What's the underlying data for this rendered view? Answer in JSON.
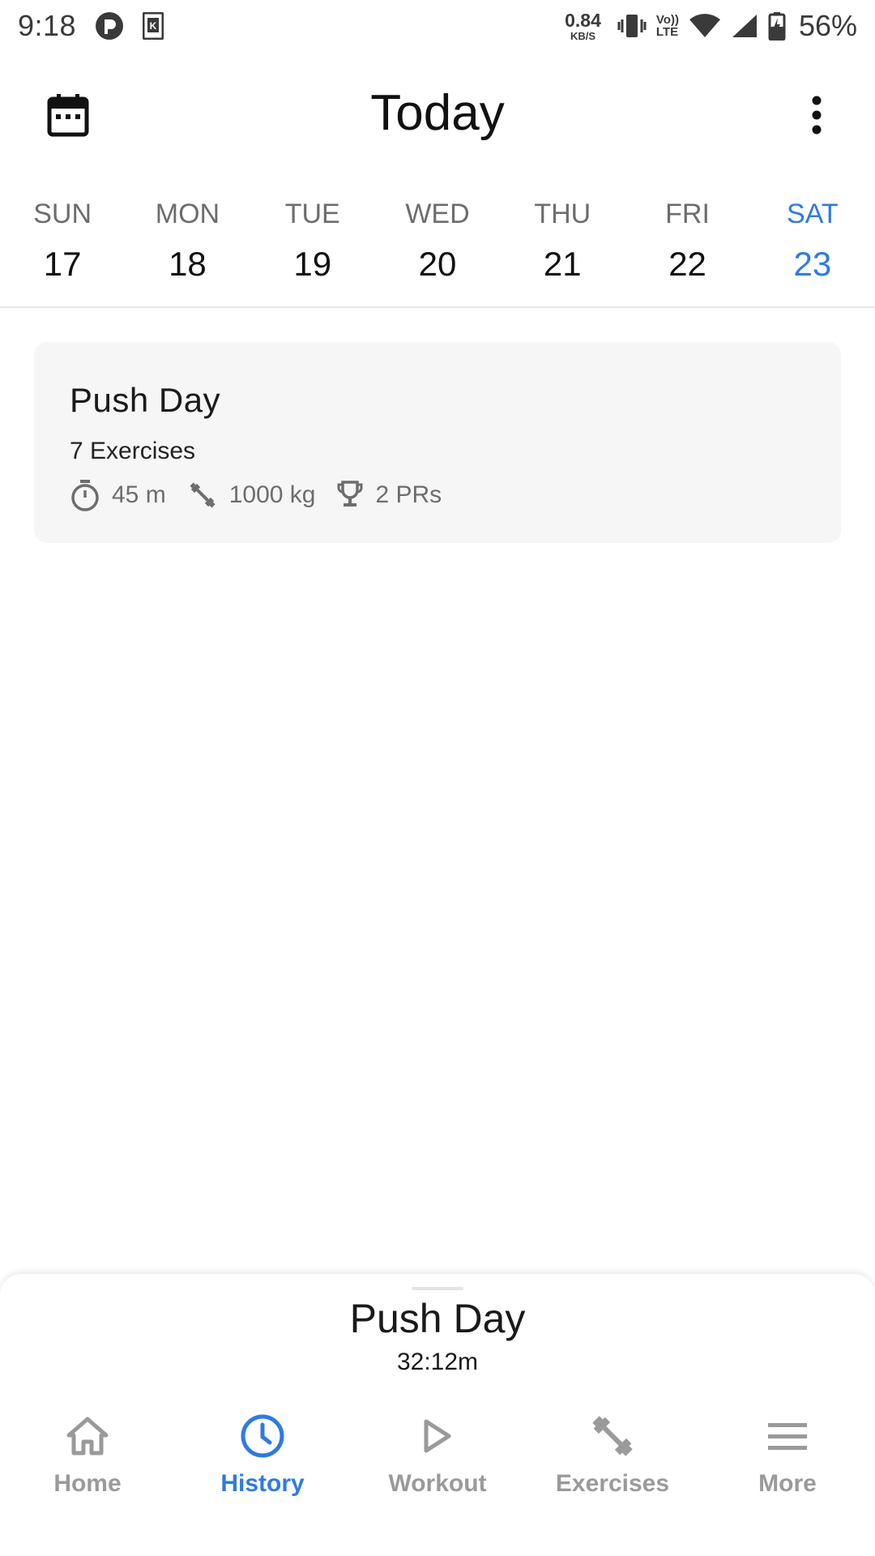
{
  "status_bar": {
    "time": "9:18",
    "net_speed_value": "0.84",
    "net_speed_unit": "KB/S",
    "volte_top": "Vo))",
    "volte_bottom": "LTE",
    "battery_pct": "56%"
  },
  "app_bar": {
    "title": "Today",
    "calendar_icon": "calendar-icon",
    "more_icon": "more-vert-icon"
  },
  "week": {
    "days": [
      {
        "name": "SUN",
        "num": "17"
      },
      {
        "name": "MON",
        "num": "18"
      },
      {
        "name": "TUE",
        "num": "19"
      },
      {
        "name": "WED",
        "num": "20"
      },
      {
        "name": "THU",
        "num": "21"
      },
      {
        "name": "FRI",
        "num": "22"
      },
      {
        "name": "SAT",
        "num": "23"
      }
    ],
    "selected_index": 6
  },
  "workout_card": {
    "title": "Push Day",
    "subtitle": "7 Exercises",
    "duration": "45 m",
    "volume": "1000 kg",
    "prs": "2 PRs"
  },
  "active_workout": {
    "title": "Push Day",
    "timer": "32:12m"
  },
  "bottom_nav": {
    "items": [
      {
        "label": "Home",
        "icon": "home-icon"
      },
      {
        "label": "History",
        "icon": "history-icon"
      },
      {
        "label": "Workout",
        "icon": "play-icon"
      },
      {
        "label": "Exercises",
        "icon": "dumbbell-icon"
      },
      {
        "label": "More",
        "icon": "menu-icon"
      }
    ],
    "active_index": 1
  },
  "colors": {
    "accent": "#2f7ae5",
    "card_bg": "#f6f6f6",
    "muted_text": "#6d6d6d",
    "nav_inactive": "#9a9a9a"
  }
}
